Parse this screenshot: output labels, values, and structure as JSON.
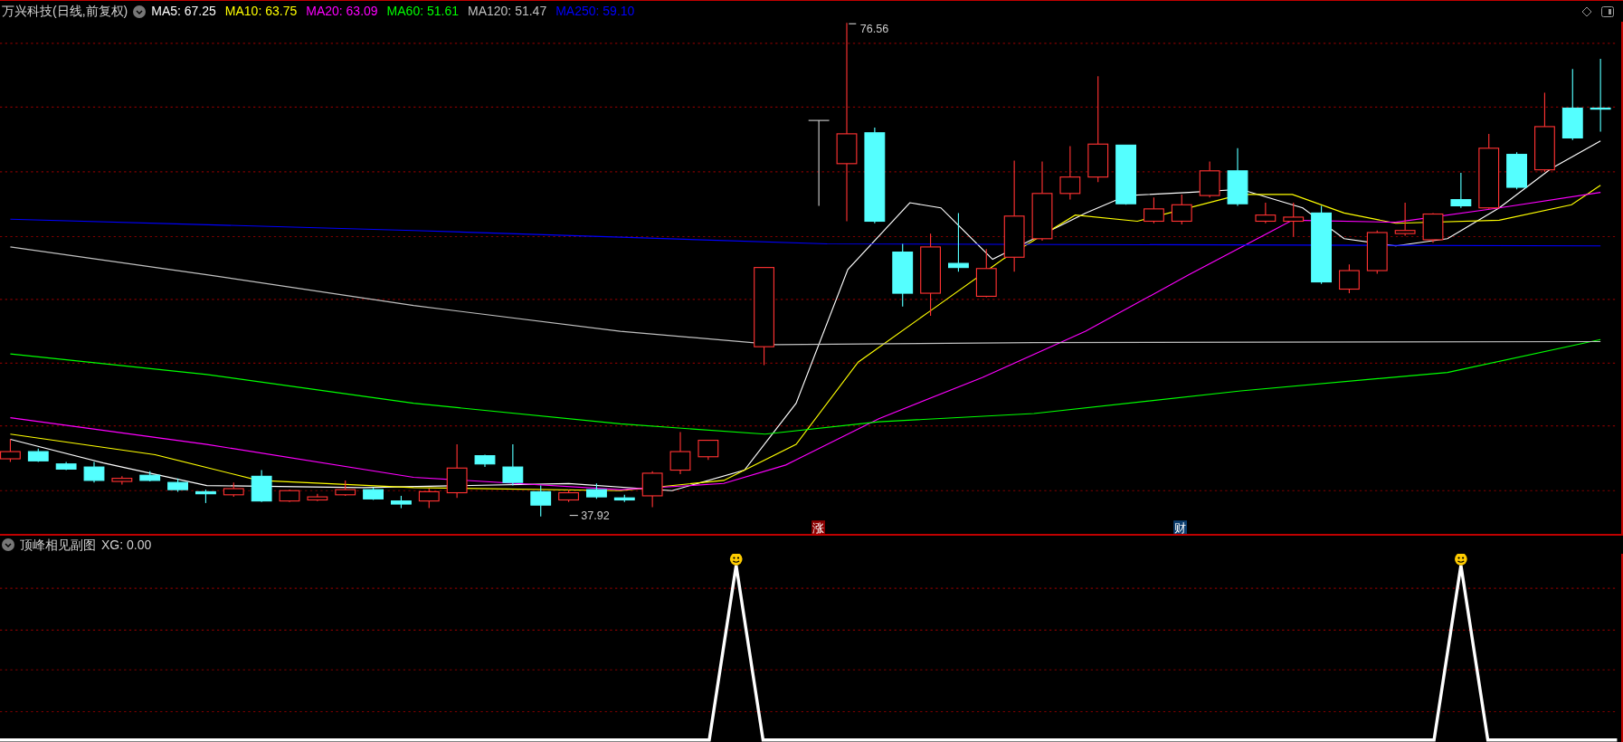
{
  "window": {
    "title": "万兴科技(日线,前复权)"
  },
  "indicators": [
    {
      "label": "MA5: 67.25",
      "color": "#ffffff"
    },
    {
      "label": "MA10: 63.75",
      "color": "#ffff00"
    },
    {
      "label": "MA20: 63.09",
      "color": "#ff00ff"
    },
    {
      "label": "MA60: 51.61",
      "color": "#00ff00"
    },
    {
      "label": "MA120: 51.47",
      "color": "#c0c0c0"
    },
    {
      "label": "MA250: 59.10",
      "color": "#0000ff"
    }
  ],
  "price_labels": {
    "high": "76.56",
    "low": "37.92"
  },
  "event_markers": [
    {
      "text": "涨",
      "color": "#8b0000"
    },
    {
      "text": "财",
      "color": "#0b3d6e"
    }
  ],
  "sub_chart": {
    "title": "顶峰相见副图",
    "reading": "XG: 0.00"
  }
}
